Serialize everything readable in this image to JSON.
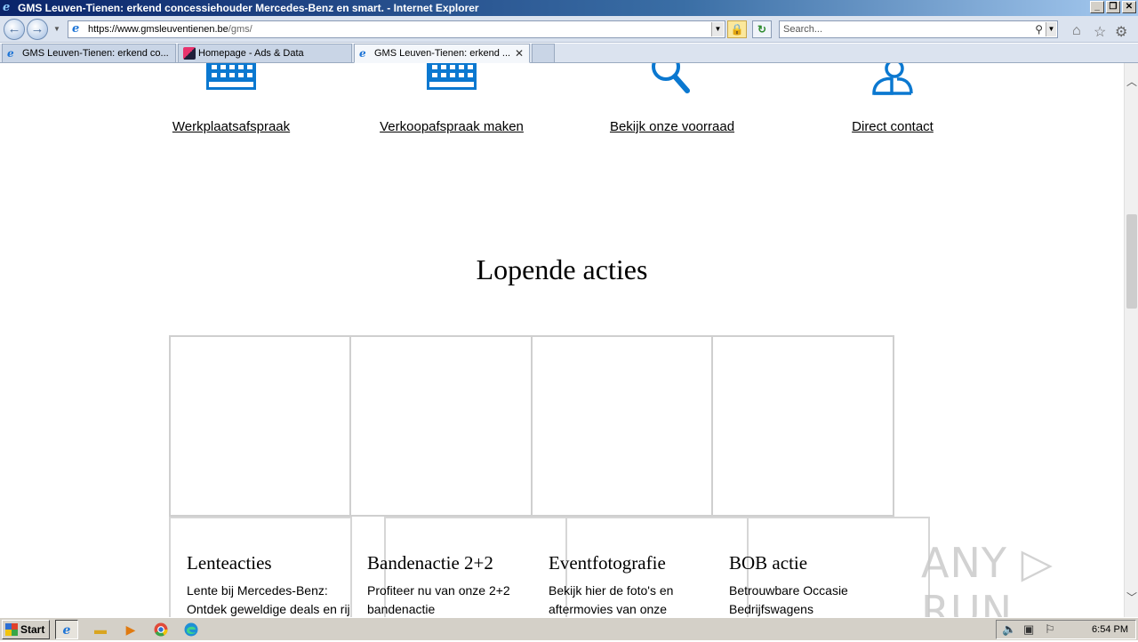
{
  "window": {
    "title": "GMS Leuven-Tienen: erkend concessiehouder Mercedes-Benz en smart. - Internet Explorer",
    "minimize": "_",
    "restore": "❐",
    "close": "✕"
  },
  "nav": {
    "back": "←",
    "forward": "→",
    "url_prefix": "https://www.",
    "url_domain": "gmsleuventienen.be",
    "url_path": "/gms/",
    "search_placeholder": "Search...",
    "lock": "🔒",
    "refresh": "↻"
  },
  "tabs": [
    {
      "label": "GMS Leuven-Tienen: erkend co...",
      "icon": "ie-icon"
    },
    {
      "label": "Homepage - Ads & Data",
      "icon": "ads-icon"
    },
    {
      "label": "GMS Leuven-Tienen: erkend ...",
      "icon": "ie-icon",
      "active": true
    }
  ],
  "quick_links": [
    {
      "label": "Werkplaatsafspraak",
      "icon": "calendar-icon"
    },
    {
      "label": "Verkoopafspraak maken",
      "icon": "calendar-icon"
    },
    {
      "label": "Bekijk onze voorraad",
      "icon": "search-icon"
    },
    {
      "label": "Direct contact",
      "icon": "person-icon"
    }
  ],
  "section_title": "Lopende acties",
  "cards": [
    {
      "title": "Lenteacties",
      "desc1": "Lente bij Mercedes-Benz:",
      "desc2": "Ontdek geweldige deals en rij"
    },
    {
      "title": "Bandenactie 2+2",
      "desc1": "Profiteer nu van onze 2+2",
      "desc2": "bandenactie"
    },
    {
      "title": "Eventfotografie",
      "desc1": "Bekijk hier de foto's en",
      "desc2": "aftermovies van onze"
    },
    {
      "title": "BOB actie",
      "desc1": "Betrouwbare Occasie",
      "desc2": "Bedrijfswagens"
    }
  ],
  "watermark": "ANY ▷ RUN",
  "taskbar": {
    "start": "Start",
    "clock": "6:54 PM"
  },
  "colors": {
    "accent_blue": "#0b78d0"
  }
}
